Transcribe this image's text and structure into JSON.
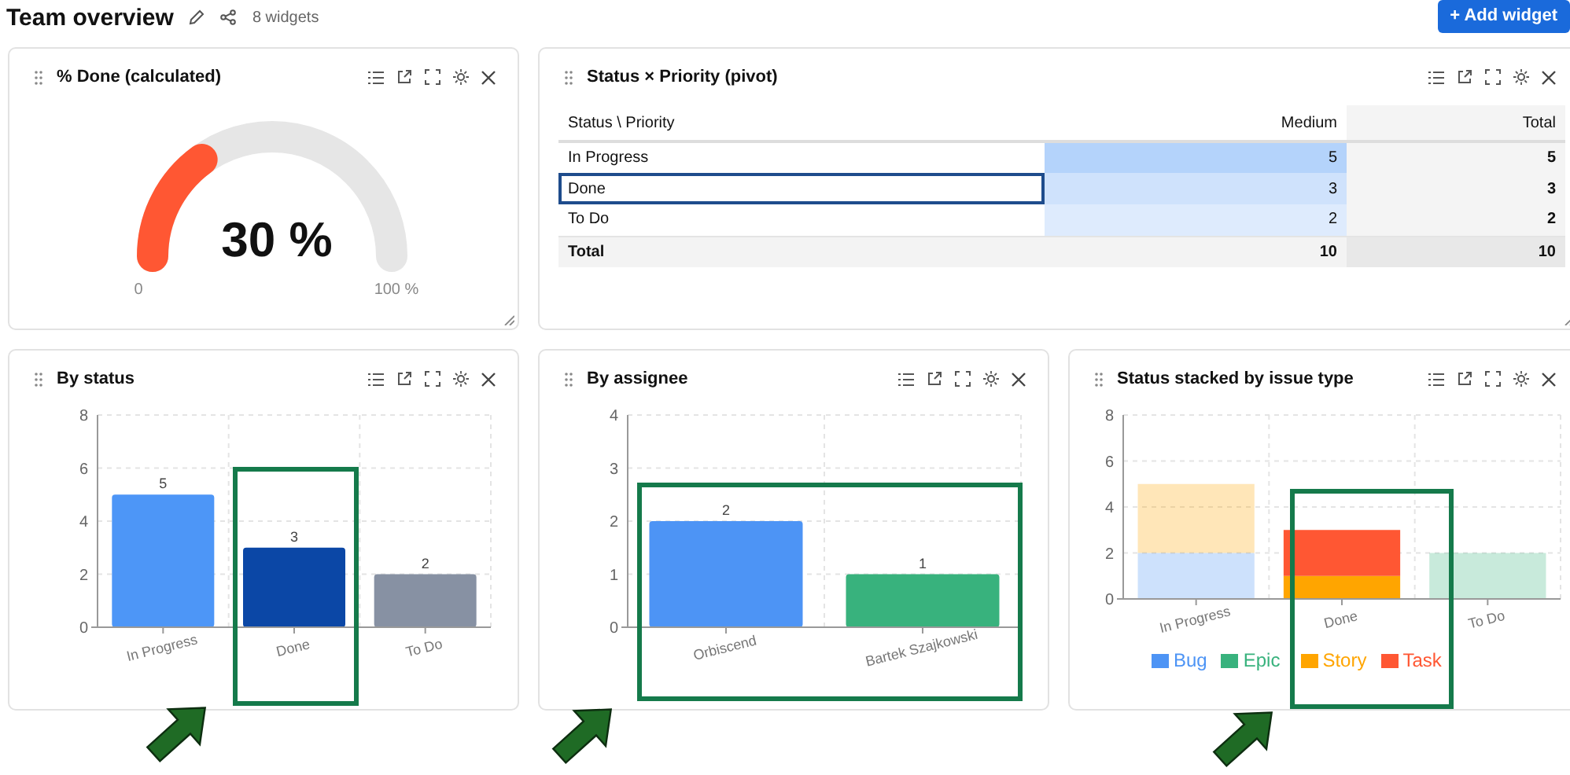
{
  "header": {
    "title": "Team overview",
    "widget_count": "8 widgets",
    "add_button": "+ Add widget"
  },
  "widgets": [
    {
      "kind": "gauge",
      "title": "% Done (calculated)",
      "value": "30 %",
      "min_label": "0",
      "max_label": "100 %"
    },
    {
      "kind": "pivot",
      "title": "Status × Priority (pivot)",
      "columns": [
        "Status \\ Priority",
        "Medium",
        "Total"
      ],
      "rows": [
        {
          "label": "In Progress",
          "medium": "5",
          "total": "5",
          "color": "#b4d3fb",
          "selected": false
        },
        {
          "label": "Done",
          "medium": "3",
          "total": "3",
          "color": "#cfe2fc",
          "selected": true
        },
        {
          "label": "To Do",
          "medium": "2",
          "total": "2",
          "color": "#deebfd",
          "selected": false
        }
      ],
      "total_row": {
        "label": "Total",
        "medium": "10",
        "total": "10"
      }
    },
    {
      "kind": "chart",
      "title": "By status",
      "chart_data": {
        "type": "bar",
        "grid": true,
        "categories": [
          "In Progress",
          "Done",
          "To Do"
        ],
        "values": [
          5,
          3,
          2
        ],
        "colors": [
          "#4d96f7",
          "#0b47a6",
          "#8791a3"
        ],
        "ylim": [
          0,
          8
        ],
        "yticks": [
          0,
          2,
          4,
          6,
          8
        ],
        "data_labels": true
      }
    },
    {
      "kind": "chart",
      "title": "By assignee",
      "chart_data": {
        "type": "bar",
        "grid": true,
        "categories": [
          "Orbiscend",
          "Bartek Szajkowski"
        ],
        "values": [
          2,
          1
        ],
        "colors": [
          "#4d94f5",
          "#38b27d"
        ],
        "ylim": [
          0,
          4
        ],
        "yticks": [
          0,
          1,
          2,
          3,
          4
        ],
        "data_labels": true
      }
    },
    {
      "kind": "chart",
      "title": "Status stacked by issue type",
      "faded": [
        true,
        false,
        true
      ],
      "chart_data": {
        "type": "bar",
        "stacked": true,
        "grid": true,
        "legend": "bottom",
        "categories": [
          "In Progress",
          "Done",
          "To Do"
        ],
        "ylim": [
          0,
          8
        ],
        "yticks": [
          0,
          2,
          4,
          6,
          8
        ],
        "series": [
          {
            "name": "Bug",
            "color": "#4d94f5",
            "values": [
              2,
              0,
              0
            ]
          },
          {
            "name": "Epic",
            "color": "#38b27d",
            "values": [
              0,
              0,
              2
            ]
          },
          {
            "name": "Story",
            "color": "#ffa500",
            "values": [
              3,
              1,
              0
            ]
          },
          {
            "name": "Task",
            "color": "#ff5733",
            "values": [
              0,
              2,
              0
            ]
          }
        ]
      }
    }
  ]
}
